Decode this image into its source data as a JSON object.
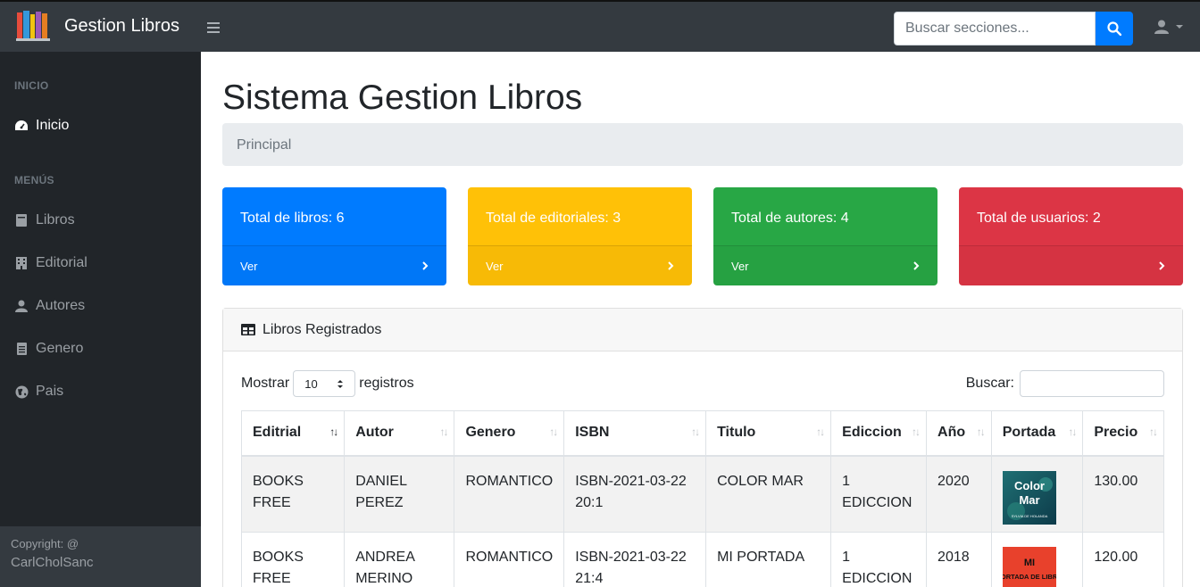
{
  "app": {
    "title": "Gestion Libros"
  },
  "search": {
    "placeholder": "Buscar secciones..."
  },
  "sidebar": {
    "heading_inicio": "INICIO",
    "heading_menus": "MENÚS",
    "items": [
      {
        "label": "Inicio",
        "icon": "dashboard-icon"
      },
      {
        "label": "Libros",
        "icon": "book-icon"
      },
      {
        "label": "Editorial",
        "icon": "building-icon"
      },
      {
        "label": "Autores",
        "icon": "user-icon"
      },
      {
        "label": "Genero",
        "icon": "file-icon"
      },
      {
        "label": "Pais",
        "icon": "globe-icon"
      }
    ],
    "footer_line1": "Copyright: @",
    "footer_line2": "CarlCholSanc"
  },
  "main": {
    "title": "Sistema Gestion Libros",
    "breadcrumb": "Principal"
  },
  "cards": [
    {
      "text": "Total de libros: 6",
      "link": "Ver",
      "color": "#007bff"
    },
    {
      "text": "Total de editoriales: 3",
      "link": "Ver",
      "color": "#ffc107"
    },
    {
      "text": "Total de autores: 4",
      "link": "Ver",
      "color": "#28a745"
    },
    {
      "text": "Total de usuarios: 2",
      "link": "",
      "color": "#dc3545"
    }
  ],
  "table_panel": {
    "title": "Libros Registrados",
    "show_label": "Mostrar",
    "show_value": "10",
    "records_label": "registros",
    "search_label": "Buscar:",
    "columns": [
      "Editrial",
      "Autor",
      "Genero",
      "ISBN",
      "Titulo",
      "Ediccion",
      "Año",
      "Portada",
      "Precio"
    ],
    "rows": [
      {
        "editorial": "BOOKS FREE",
        "autor": "DANIEL PEREZ",
        "genero": "ROMANTICO",
        "isbn": "ISBN-2021-03-22 20:1",
        "titulo": "COLOR MAR",
        "ediccion": "1 EDICCION",
        "anio": "2020",
        "portada_text1": "Color",
        "portada_text2": "Mar",
        "portada_sub": "SYLVIA DE HOLANDA",
        "precio": "130.00"
      },
      {
        "editorial": "BOOKS FREE",
        "autor": "ANDREA MERINO",
        "genero": "ROMANTICO",
        "isbn": "ISBN-2021-03-22 21:4",
        "titulo": "MI PORTADA",
        "ediccion": "1 EDICCION",
        "anio": "2018",
        "portada_text1": "MI",
        "portada_text2": "PORTADA DE LIBRO",
        "portada_sub": "",
        "precio": "120.00"
      }
    ]
  }
}
